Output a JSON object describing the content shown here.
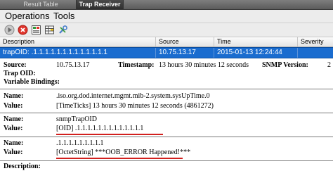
{
  "tabs": [
    {
      "label": "Result Table",
      "active": false
    },
    {
      "label": "Trap Receiver",
      "active": true
    }
  ],
  "menu": {
    "operations": "Operations",
    "tools": "Tools"
  },
  "toolbar": [
    {
      "icon": "play-icon"
    },
    {
      "icon": "stop-icon"
    },
    {
      "icon": "export-icon"
    },
    {
      "icon": "table-icon"
    },
    {
      "icon": "settings-icon"
    }
  ],
  "table": {
    "columns": [
      "Description",
      "Source",
      "Time",
      "Severity"
    ],
    "selected_row": {
      "description": "trapOID: .1.1.1.1.1.1.1.1.1.1.1.1.1",
      "source": "10.75.13.17",
      "time": "2015-01-13 12:24:44",
      "severity": ""
    }
  },
  "details": {
    "source_label": "Source:",
    "source_value": "10.75.13.17",
    "timestamp_label": "Timestamp:",
    "timestamp_value": "13 hours 30 minutes 12 seconds",
    "snmp_version_label": "SNMP Version:",
    "snmp_version_value": "2",
    "trap_oid_label": "Trap OID:",
    "varbinds_label": "Variable Bindings:",
    "bindings": [
      {
        "name_label": "Name:",
        "name": ".iso.org.dod.internet.mgmt.mib-2.system.sysUpTime.0",
        "value_label": "Value:",
        "value": "[TimeTicks] 13 hours 30 minutes 12 seconds (4861272)"
      },
      {
        "name_label": "Name:",
        "name": "snmpTrapOID",
        "value_label": "Value:",
        "value": "[OID] .1.1.1.1.1.1.1.1.1.1.1.1.1"
      },
      {
        "name_label": "Name:",
        "name": ".1.1.1.1.1.1.1.1.1",
        "value_label": "Value:",
        "value": "[OctetString] ***OOB_ERROR Happened!***"
      }
    ],
    "description_label": "Description:"
  },
  "colors": {
    "selection": "#1a6ccf",
    "underline": "#d2201e"
  }
}
